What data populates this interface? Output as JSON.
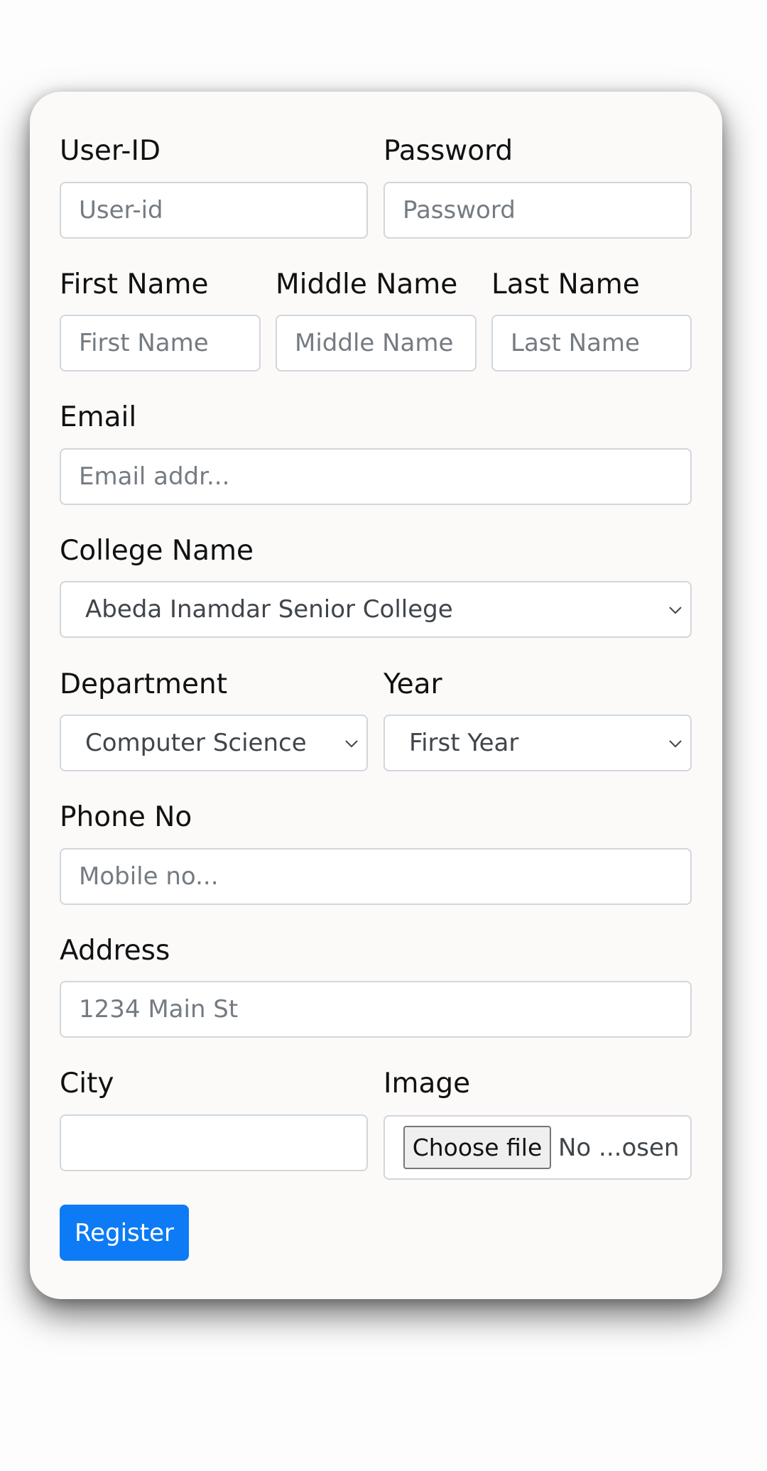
{
  "form": {
    "user_id": {
      "label": "User-ID",
      "placeholder": "User-id"
    },
    "password": {
      "label": "Password",
      "placeholder": "Password"
    },
    "first_name": {
      "label": "First Name",
      "placeholder": "First Name"
    },
    "middle_name": {
      "label": "Middle Name",
      "placeholder": "Middle Name"
    },
    "last_name": {
      "label": "Last Name",
      "placeholder": "Last Name"
    },
    "email": {
      "label": "Email",
      "placeholder": "Email addr..."
    },
    "college": {
      "label": "College Name",
      "selected": "Abeda Inamdar Senior College"
    },
    "department": {
      "label": "Department",
      "selected": "Computer Science"
    },
    "year": {
      "label": "Year",
      "selected": "First Year"
    },
    "phone": {
      "label": "Phone No",
      "placeholder": "Mobile no..."
    },
    "address": {
      "label": "Address",
      "placeholder": "1234 Main St"
    },
    "city": {
      "label": "City",
      "value": ""
    },
    "image": {
      "label": "Image",
      "button": "Choose file",
      "status": "No ...osen"
    },
    "register_label": "Register"
  },
  "colors": {
    "primary": "#0d7bf5",
    "card_bg": "#fbfaf9",
    "border": "#d3d6da",
    "placeholder": "#747b82"
  }
}
